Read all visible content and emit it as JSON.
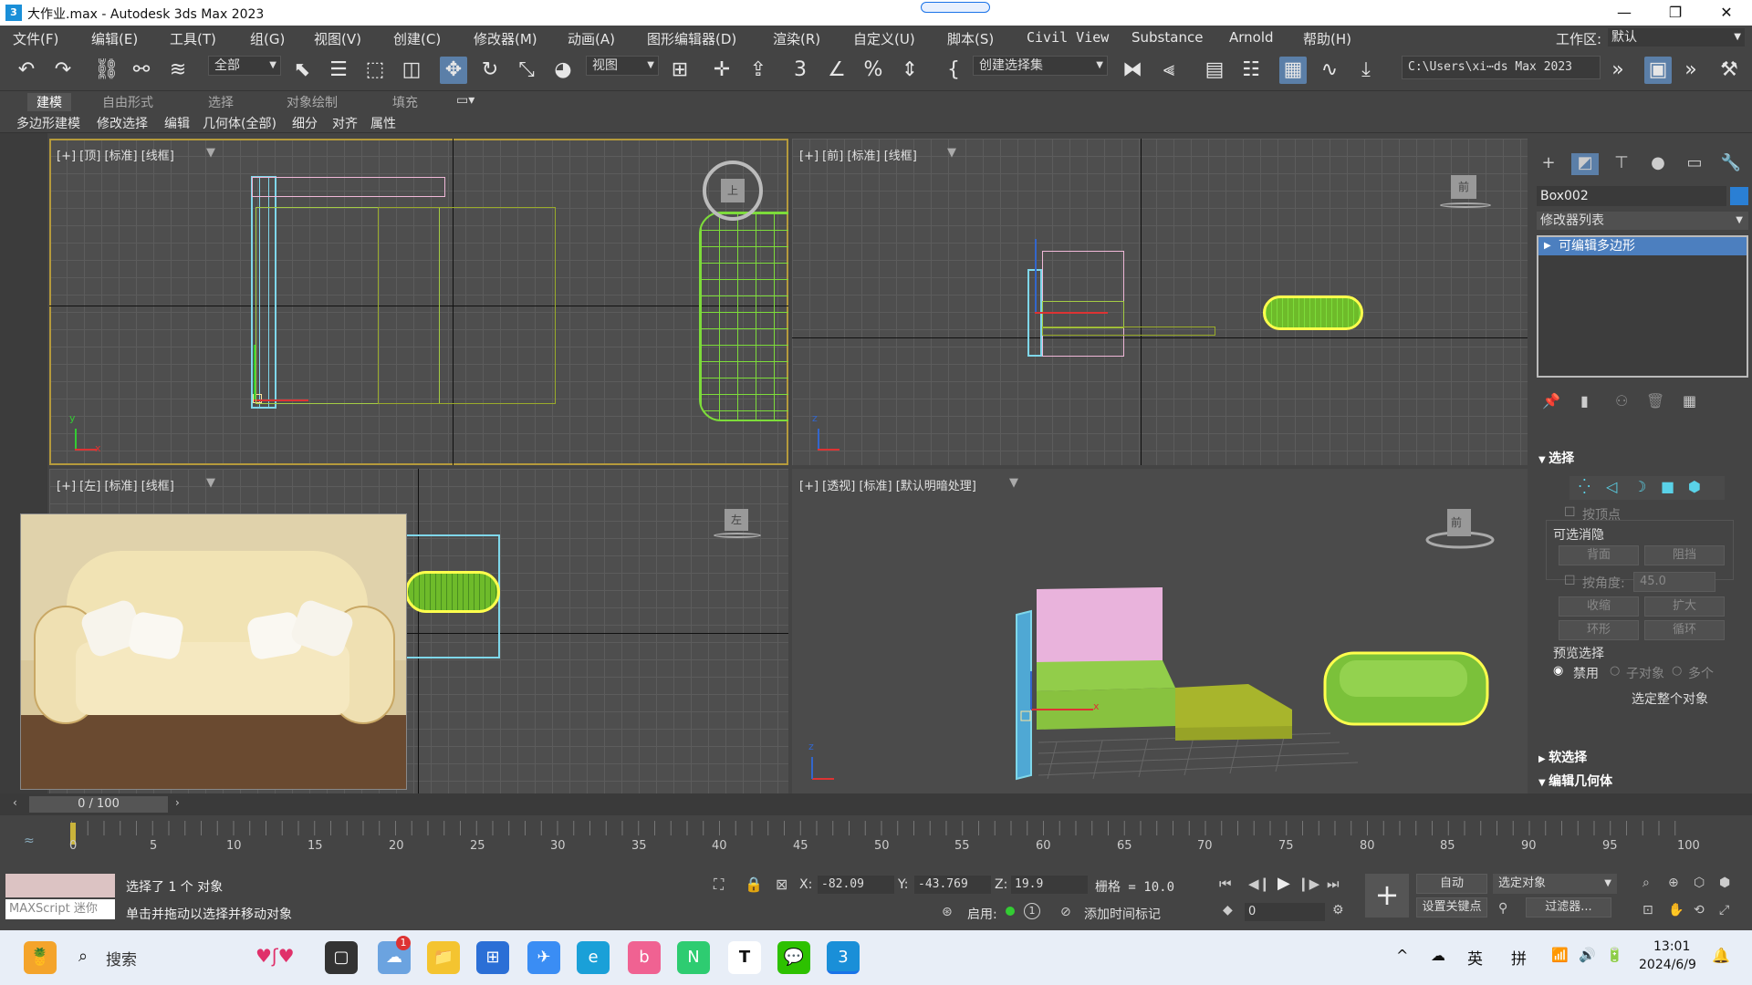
{
  "window": {
    "title": "大作业.max - Autodesk 3ds Max 2023",
    "app_icon": "3",
    "min_glyph": "—",
    "max_glyph": "❐",
    "close_glyph": "✕"
  },
  "menu": {
    "items": [
      "文件(F)",
      "编辑(E)",
      "工具(T)",
      "组(G)",
      "视图(V)",
      "创建(C)",
      "修改器(M)",
      "动画(A)",
      "图形编辑器(D)",
      "渲染(R)",
      "自定义(U)",
      "脚本(S)",
      "Civil View",
      "Substance",
      "Arnold",
      "帮助(H)"
    ],
    "workspace_label": "工作区:",
    "workspace_value": "默认"
  },
  "toolbar": {
    "filter_value": "全部",
    "refcoord_value": "视图",
    "selection_set_placeholder": "创建选择集",
    "path_value": "C:\\Users\\xi⋯ds Max 2023"
  },
  "ribbon": {
    "tabs": [
      "建模",
      "自由形式",
      "选择",
      "对象绘制",
      "填充"
    ],
    "subtabs": [
      "多边形建模",
      "修改选择",
      "编辑",
      "几何体(全部)",
      "细分",
      "对齐",
      "属性"
    ]
  },
  "viewports": {
    "top": "[+] [顶] [标准] [线框]",
    "front": "[+] [前] [标准] [线框]",
    "left": "[+] [左] [标准] [线框]",
    "persp": "[+] [透视] [标准] [默认明暗处理]",
    "cube_top": "上",
    "cube_front": "前",
    "cube_left": "左",
    "axis_x": "x",
    "axis_y": "y",
    "axis_z": "z"
  },
  "command_panel": {
    "object_name": "Box002",
    "modifier_list": "修改器列表",
    "stack_item": "可编辑多边形",
    "selection_title": "选择",
    "by_vertex": "按顶点",
    "backface_title": "可选消隐",
    "backface": "背面",
    "occluded": "阻挡",
    "by_angle": "按角度:",
    "angle_value": "45.0",
    "shrink": "收缩",
    "grow": "扩大",
    "ring": "环形",
    "loop": "循环",
    "preview_title": "预览选择",
    "disabled": "禁用",
    "sub_object": "子对象",
    "multi": "多个",
    "select_whole": "选定整个对象",
    "soft_select": "软选择",
    "edit_geometry": "编辑几何体"
  },
  "timeline": {
    "frame": "0 / 100",
    "ticks": [
      "0",
      "5",
      "10",
      "15",
      "20",
      "25",
      "30",
      "35",
      "40",
      "45",
      "50",
      "55",
      "60",
      "65",
      "70",
      "75",
      "80",
      "85",
      "90",
      "95",
      "100"
    ]
  },
  "status": {
    "maxscript": "MAXScript 迷你",
    "selected": "选择了 1 个 对象",
    "prompt": "单击并拖动以选择并移动对象",
    "x_label": "X:",
    "x": "-82.09",
    "y_label": "Y:",
    "y": "-43.769",
    "z_label": "Z:",
    "z": "19.9",
    "grid": "栅格 = 10.0",
    "enable": "启用:",
    "add_time_tag": "添加时间标记",
    "auto": "自动",
    "selected_object": "选定对象",
    "set_key": "设置关键点",
    "filters": "过滤器...",
    "frame_field": "0"
  },
  "taskbar": {
    "search": "搜索",
    "badge": "1",
    "ime1": "英",
    "ime2": "拼",
    "time": "13:01",
    "date": "2024/6/9"
  }
}
